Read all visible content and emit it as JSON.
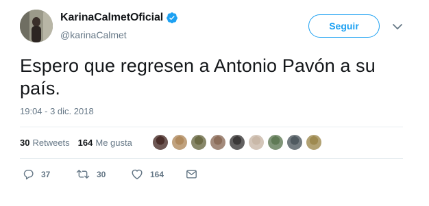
{
  "user": {
    "display_name": "KarinaCalmetOficial",
    "handle": "@karinaCalmet",
    "verified": true
  },
  "follow_button": {
    "label": "Seguir"
  },
  "tweet": {
    "text": "Espero que regresen a Antonio Pavón a su país.",
    "timestamp": "19:04 - 3 dic. 2018"
  },
  "stats": {
    "retweets_count": "30",
    "retweets_label": "Retweets",
    "likes_count": "164",
    "likes_label": "Me gusta"
  },
  "likers": [
    {
      "color": "#4a2e2a"
    },
    {
      "color": "#b08a5e"
    },
    {
      "color": "#6b6a45"
    },
    {
      "color": "#8c6d5a"
    },
    {
      "color": "#3a3838"
    },
    {
      "color": "#c9b8a8"
    },
    {
      "color": "#5f7a55"
    },
    {
      "color": "#505a60"
    },
    {
      "color": "#9e8a50"
    }
  ],
  "actions": {
    "reply_count": "37",
    "retweet_count": "30",
    "like_count": "164"
  },
  "colors": {
    "accent": "#1da1f2",
    "muted": "#657786",
    "text": "#14171a"
  }
}
